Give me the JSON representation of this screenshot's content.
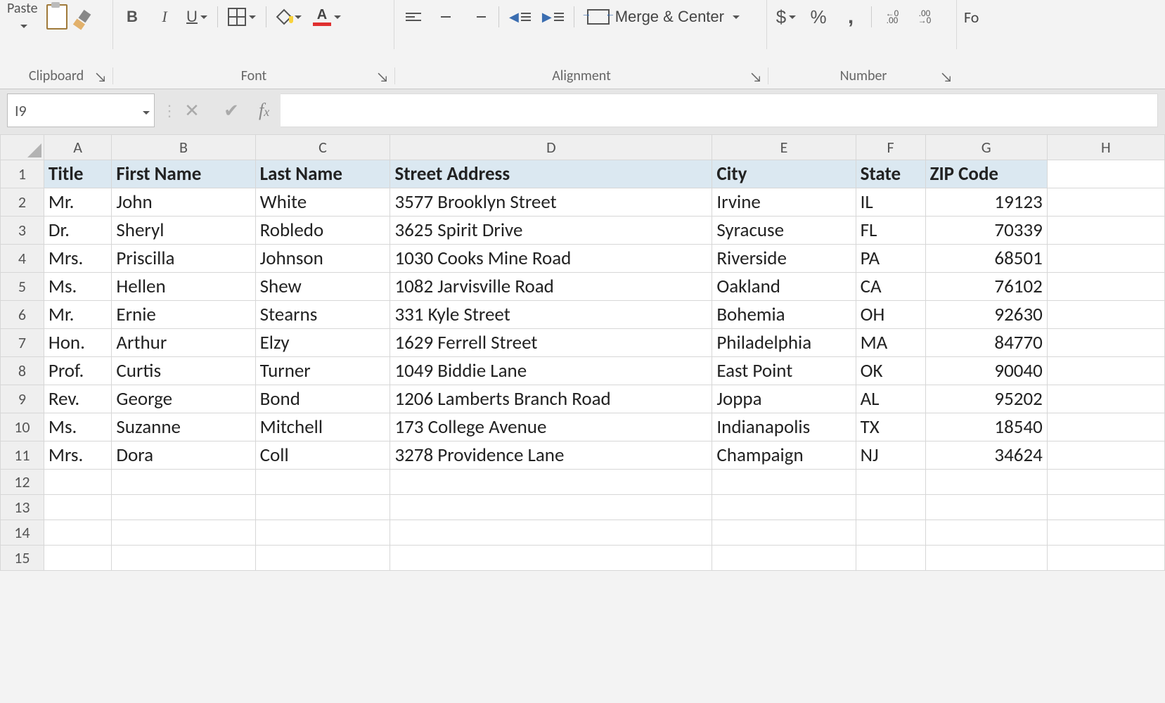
{
  "ribbon": {
    "clipboard": {
      "paste_label": "Paste",
      "group_label": "Clipboard"
    },
    "font": {
      "group_label": "Font",
      "bold": "B",
      "italic": "I",
      "underline": "U",
      "fontcolor_glyph": "A"
    },
    "alignment": {
      "group_label": "Alignment",
      "merge_label": "Merge & Center"
    },
    "number": {
      "group_label": "Number",
      "currency": "$",
      "percent": "%",
      "comma": ",",
      "inc_dec": "",
      "dec_dec": ""
    },
    "format": {
      "partial": "Fo"
    }
  },
  "formula_bar": {
    "name_box": "I9",
    "formula": ""
  },
  "sheet": {
    "columns": [
      "A",
      "B",
      "C",
      "D",
      "E",
      "F",
      "G",
      "H"
    ],
    "row_numbers": [
      1,
      2,
      3,
      4,
      5,
      6,
      7,
      8,
      9,
      10,
      11,
      12,
      13,
      14,
      15
    ],
    "headers": [
      "Title",
      "First Name",
      "Last Name",
      "Street Address",
      "City",
      "State",
      "ZIP Code"
    ],
    "rows": [
      {
        "title": "Mr.",
        "first": "John",
        "last": "White",
        "street": "3577 Brooklyn Street",
        "city": "Irvine",
        "state": "IL",
        "zip": "19123"
      },
      {
        "title": "Dr.",
        "first": "Sheryl",
        "last": "Robledo",
        "street": "3625 Spirit Drive",
        "city": "Syracuse",
        "state": "FL",
        "zip": "70339"
      },
      {
        "title": "Mrs.",
        "first": "Priscilla",
        "last": "Johnson",
        "street": "1030 Cooks Mine Road",
        "city": "Riverside",
        "state": "PA",
        "zip": "68501"
      },
      {
        "title": "Ms.",
        "first": "Hellen",
        "last": "Shew",
        "street": "1082 Jarvisville Road",
        "city": "Oakland",
        "state": "CA",
        "zip": "76102"
      },
      {
        "title": "Mr.",
        "first": "Ernie",
        "last": "Stearns",
        "street": "331 Kyle Street",
        "city": "Bohemia",
        "state": "OH",
        "zip": "92630"
      },
      {
        "title": "Hon.",
        "first": "Arthur",
        "last": "Elzy",
        "street": "1629 Ferrell Street",
        "city": "Philadelphia",
        "state": "MA",
        "zip": "84770"
      },
      {
        "title": "Prof.",
        "first": "Curtis",
        "last": "Turner",
        "street": "1049 Biddie Lane",
        "city": "East Point",
        "state": "OK",
        "zip": "90040"
      },
      {
        "title": "Rev.",
        "first": "George",
        "last": "Bond",
        "street": "1206 Lamberts Branch Road",
        "city": "Joppa",
        "state": "AL",
        "zip": "95202"
      },
      {
        "title": "Ms.",
        "first": "Suzanne",
        "last": "Mitchell",
        "street": "173 College Avenue",
        "city": "Indianapolis",
        "state": "TX",
        "zip": "18540"
      },
      {
        "title": "Mrs.",
        "first": "Dora",
        "last": "Coll",
        "street": "3278 Providence Lane",
        "city": "Champaign",
        "state": "NJ",
        "zip": "34624"
      }
    ]
  }
}
